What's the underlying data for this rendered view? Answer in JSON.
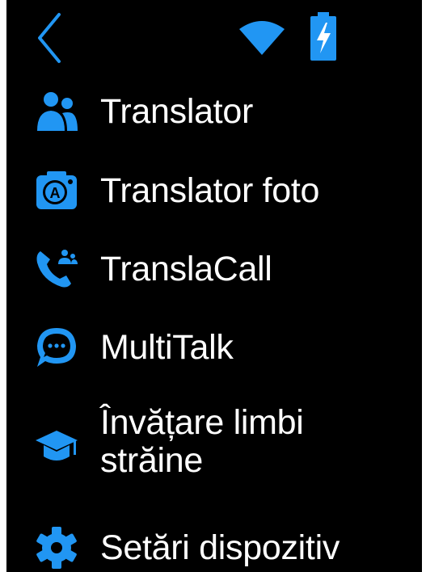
{
  "status_bar": {
    "back_icon": "chevron-left-icon",
    "wifi_icon": "wifi-icon",
    "battery_icon": "battery-charging-icon",
    "accent_color": "#2196F3"
  },
  "menu": {
    "items": [
      {
        "icon": "users-icon",
        "label": "Translator"
      },
      {
        "icon": "camera-translate-icon",
        "label": "Translator foto"
      },
      {
        "icon": "phone-call-group-icon",
        "label": "TranslaCall"
      },
      {
        "icon": "chat-bubble-icon",
        "label": "MultiTalk"
      },
      {
        "icon": "graduation-cap-icon",
        "label": "Învățare limbi străine"
      },
      {
        "icon": "gear-icon",
        "label": "Setări dispozitiv"
      }
    ]
  },
  "colors": {
    "background": "#000000",
    "text": "#FFFFFF",
    "icon": "#2196F3"
  }
}
